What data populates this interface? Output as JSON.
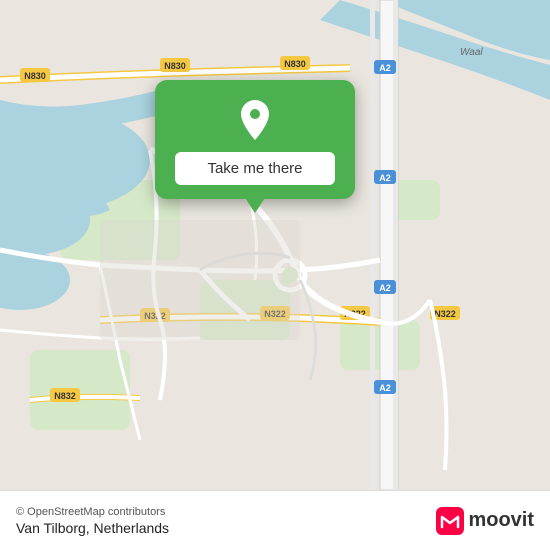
{
  "map": {
    "attribution": "© OpenStreetMap contributors",
    "location_name": "Van Tilborg, Netherlands",
    "popup": {
      "button_label": "Take me there"
    },
    "moovit_logo": "moovit",
    "colors": {
      "map_bg": "#e8e0d8",
      "water": "#aad3df",
      "road_main": "#ffffff",
      "road_secondary": "#f5c842",
      "popup_bg": "#4caf50",
      "pin_fill": "#4caf50",
      "pin_circle": "#ffffff"
    },
    "road_labels": [
      "N830",
      "N830",
      "N322",
      "N322",
      "N322",
      "N832",
      "A2",
      "A2",
      "A2",
      "Waal"
    ]
  }
}
